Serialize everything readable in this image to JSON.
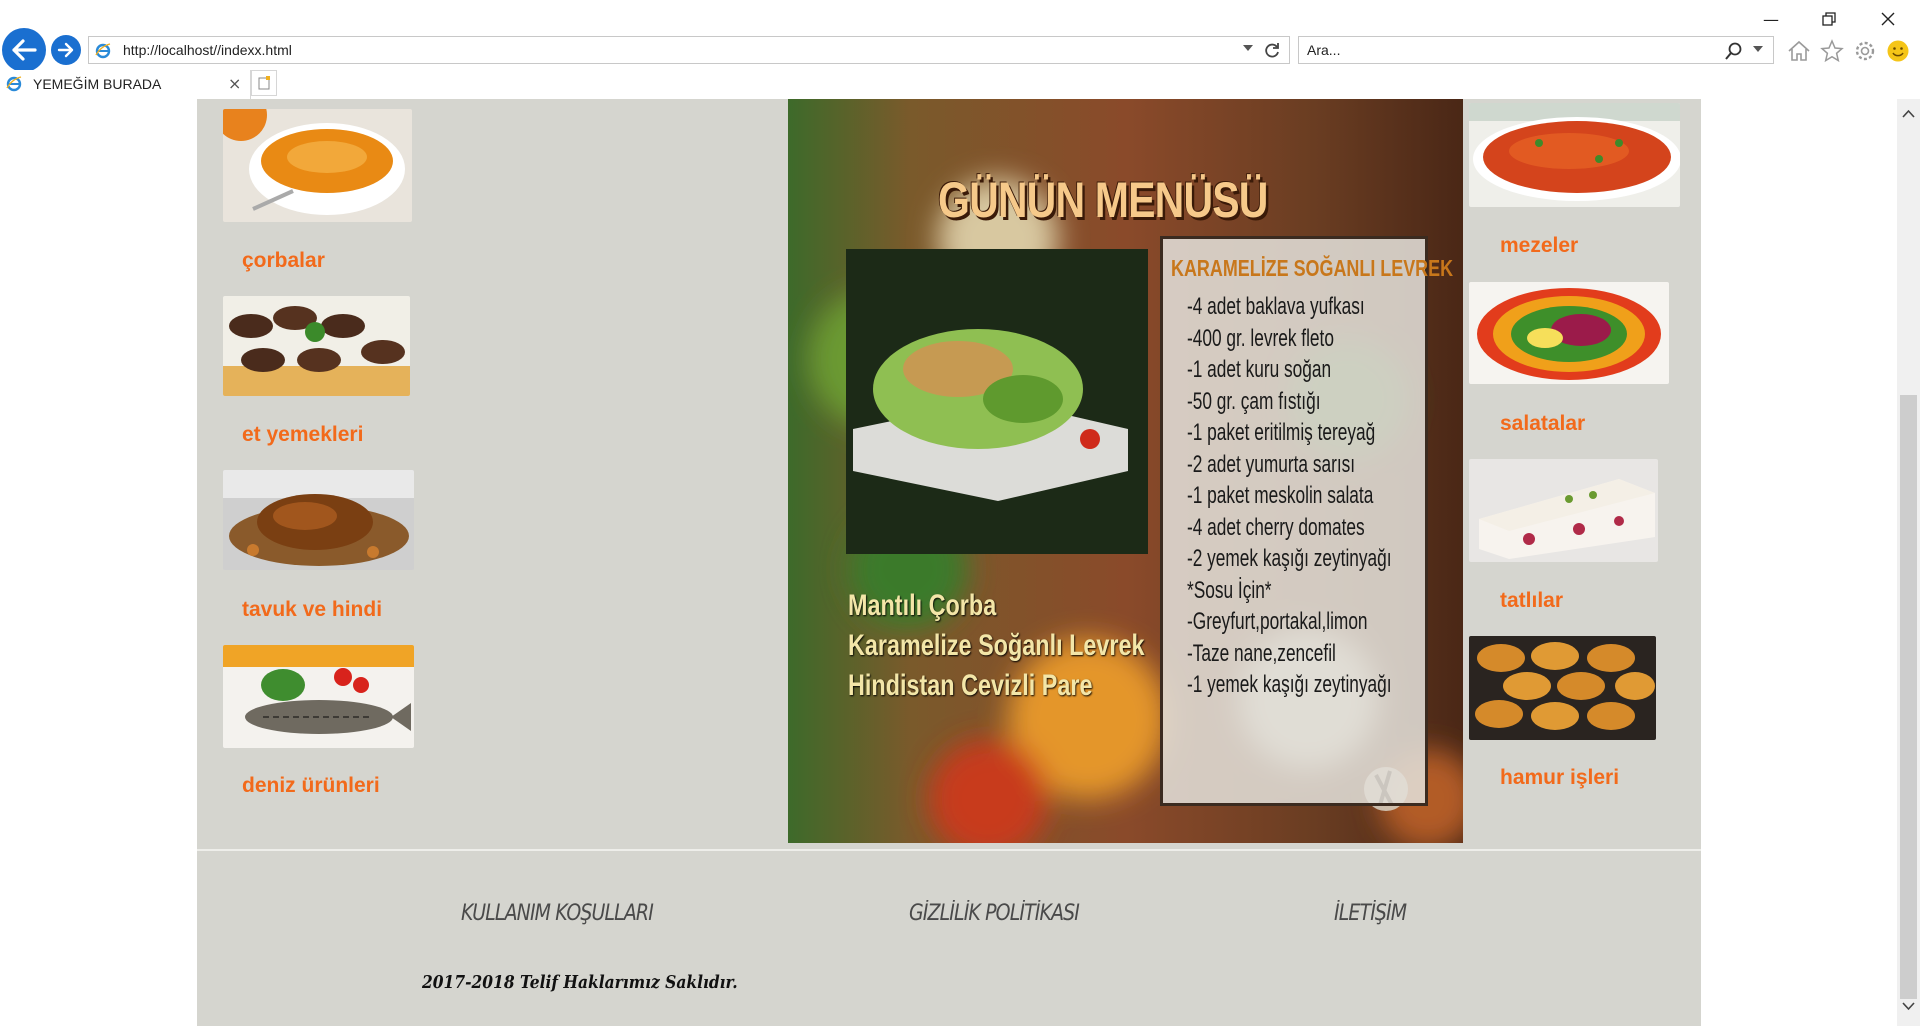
{
  "browser": {
    "url": "http://localhost//indexx.html",
    "search_placeholder": "Ara...",
    "tab_title": "YEMEĞİM BURADA"
  },
  "left_categories": [
    {
      "label": "çorbalar",
      "image": "soup"
    },
    {
      "label": "et yemekleri",
      "image": "meatballs"
    },
    {
      "label": "tavuk ve hindi",
      "image": "roast-turkey"
    },
    {
      "label": "deniz ürünleri",
      "image": "grilled-fish"
    }
  ],
  "right_categories": [
    {
      "label": "mezeler",
      "image": "ezme-meze"
    },
    {
      "label": "salatalar",
      "image": "colorful-salad"
    },
    {
      "label": "tatlılar",
      "image": "cake-slice"
    },
    {
      "label": "hamur işleri",
      "image": "pastries"
    }
  ],
  "menu_poster": {
    "title": "GÜNÜN MENÜSÜ",
    "dishes": [
      "Mantılı Çorba",
      "Karamelize Soğanlı Levrek",
      "Hindistan Cevizli Pare"
    ],
    "recipe_title": "KARAMELİZE SOĞANLI LEVREK",
    "recipe_lines": [
      "-4 adet baklava yufkası",
      "-400 gr. levrek fleto",
      "-1 adet kuru soğan",
      "-50 gr. çam fıstığı",
      "-1 paket eritilmiş tereyağ",
      "-2 adet yumurta sarısı",
      "-1 paket meskolin salata",
      "-4 adet cherry domates",
      "-2 yemek kaşığı zeytinyağı",
      "*Sosu İçin*",
      "-Greyfurt,portakal,limon",
      "-Taze nane,zencefil",
      "-1 yemek kaşığı zeytinyağı"
    ]
  },
  "footer": {
    "links": [
      "KULLANIM KOŞULLARI",
      "GİZLİLİK POLİTİKASI",
      "İLETİŞİM"
    ],
    "copyright": "2017-2018 Telif Haklarımız Saklıdır."
  },
  "colors": {
    "accent": "#f26a1b",
    "page_bg": "#d5d5cf",
    "browser_blue": "#1a6fd0"
  }
}
